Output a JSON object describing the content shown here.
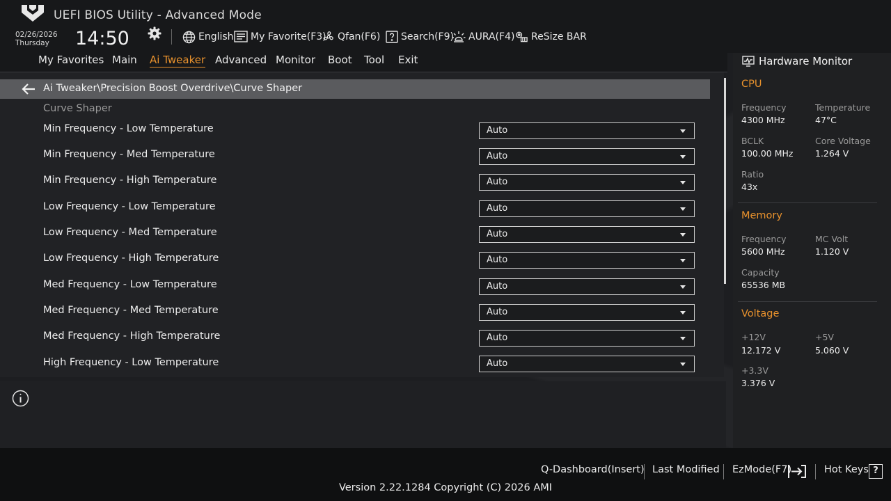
{
  "app": {
    "title": "UEFI BIOS Utility - Advanced Mode"
  },
  "clock": {
    "date": "02/26/2026",
    "day": "Thursday",
    "time": "14:50"
  },
  "toolbar": {
    "language": "English",
    "favorite": "My Favorite(F3)",
    "qfan": "Qfan(F6)",
    "search": "Search(F9)",
    "aura": "AURA(F4)",
    "resize_bar": "ReSize BAR"
  },
  "menu": {
    "items": [
      "My Favorites",
      "Main",
      "Ai Tweaker",
      "Advanced",
      "Monitor",
      "Boot",
      "Tool",
      "Exit"
    ],
    "active": "Ai Tweaker"
  },
  "page": {
    "breadcrumb": "Ai Tweaker\\Precision Boost Overdrive\\Curve Shaper",
    "section_title": "Curve Shaper",
    "rows": [
      {
        "label": "Min Frequency - Low Temperature",
        "value": "Auto"
      },
      {
        "label": "Min Frequency - Med Temperature",
        "value": "Auto"
      },
      {
        "label": "Min Frequency - High Temperature",
        "value": "Auto"
      },
      {
        "label": "Low Frequency - Low Temperature",
        "value": "Auto"
      },
      {
        "label": "Low Frequency - Med Temperature",
        "value": "Auto"
      },
      {
        "label": "Low Frequency - High Temperature",
        "value": "Auto"
      },
      {
        "label": "Med Frequency - Low Temperature",
        "value": "Auto"
      },
      {
        "label": "Med Frequency - Med Temperature",
        "value": "Auto"
      },
      {
        "label": "Med Frequency - High Temperature",
        "value": "Auto"
      },
      {
        "label": "High Frequency - Low Temperature",
        "value": "Auto"
      }
    ]
  },
  "hardware_monitor": {
    "title": "Hardware Monitor",
    "cpu": {
      "title": "CPU",
      "frequency_label": "Frequency",
      "frequency": "4300 MHz",
      "temperature_label": "Temperature",
      "temperature": "47°C",
      "bclk_label": "BCLK",
      "bclk": "100.00 MHz",
      "core_voltage_label": "Core Voltage",
      "core_voltage": "1.264 V",
      "ratio_label": "Ratio",
      "ratio": "43x"
    },
    "memory": {
      "title": "Memory",
      "frequency_label": "Frequency",
      "frequency": "5600 MHz",
      "mc_volt_label": "MC Volt",
      "mc_volt": "1.120 V",
      "capacity_label": "Capacity",
      "capacity": "65536 MB"
    },
    "voltage": {
      "title": "Voltage",
      "v12_label": "+12V",
      "v12": "12.172 V",
      "v5_label": "+5V",
      "v5": "5.060 V",
      "v33_label": "+3.3V",
      "v33": "3.376 V"
    }
  },
  "footer": {
    "q_dashboard": "Q-Dashboard(Insert)",
    "last_modified": "Last Modified",
    "ezmode": "EzMode(F7)",
    "hot_keys": "Hot Keys",
    "hot_keys_glyph": "?",
    "version": "Version 2.22.1284 Copyright (C) 2026 AMI"
  },
  "colors": {
    "accent": "#e9922d",
    "background": "#1d1e21",
    "panel": "#212225",
    "breadcrumb_bar": "#5a5b5e"
  }
}
